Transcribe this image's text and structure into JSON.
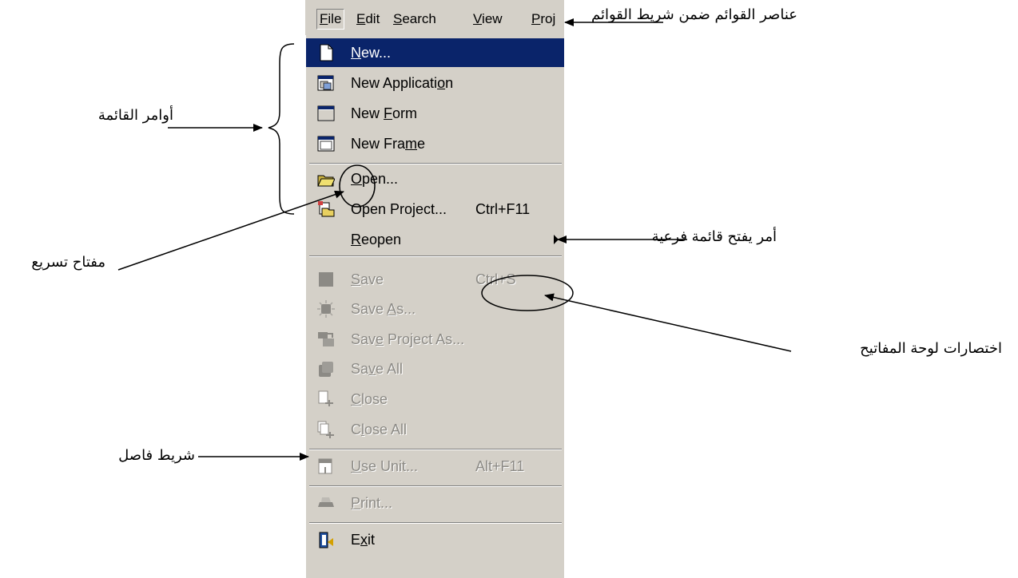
{
  "menubar": {
    "items": [
      {
        "label": "File",
        "accel": "F"
      },
      {
        "label": "Edit",
        "accel": "E"
      },
      {
        "label": "Search",
        "accel": "S"
      },
      {
        "label": "View",
        "accel": "V"
      },
      {
        "label": "Proj",
        "accel": "P"
      }
    ]
  },
  "menu": {
    "items": [
      {
        "icon": "new-file-icon",
        "label": "New...",
        "highlighted": true
      },
      {
        "icon": "new-application-icon",
        "label": "New Application"
      },
      {
        "icon": "new-form-icon",
        "label": "New Form"
      },
      {
        "icon": "new-frame-icon",
        "label": "New Frame"
      },
      {
        "icon": "open-folder-icon",
        "label": "Open..."
      },
      {
        "icon": "open-project-icon",
        "label": "Open Project...",
        "shortcut": "Ctrl+F11"
      },
      {
        "label": "Reopen",
        "submenu": true
      },
      {
        "icon": "save-icon",
        "label": "Save",
        "shortcut": "Ctrl+S",
        "disabled": true
      },
      {
        "icon": "save-as-icon",
        "label": "Save As...",
        "disabled": true
      },
      {
        "icon": "save-project-as-icon",
        "label": "Save Project As...",
        "disabled": true
      },
      {
        "icon": "save-all-icon",
        "label": "Save All",
        "disabled": true
      },
      {
        "icon": "close-icon",
        "label": "Close",
        "disabled": true
      },
      {
        "icon": "close-all-icon",
        "label": "Close All",
        "disabled": true
      },
      {
        "icon": "use-unit-icon",
        "label": "Use Unit...",
        "shortcut": "Alt+F11",
        "disabled": true
      },
      {
        "icon": "print-icon",
        "label": "Print...",
        "disabled": true
      },
      {
        "icon": "exit-icon",
        "label": "Exit"
      }
    ]
  },
  "annotations": {
    "menubar_items": "عناصر القوائم ضمن شريط القوائم",
    "menu_commands": "أوامر القائمة",
    "accelerator_key": "مفتاح تسريع",
    "submenu_command": "أمر يفتح قائمة فرعية",
    "keyboard_shortcuts": "اختصارات لوحة المفاتيح",
    "separator_bar": "شريط فاصل"
  },
  "colors": {
    "menu_background": "#d4d0c8",
    "highlight": "#0a246a",
    "disabled_text": "#8c8a85"
  }
}
